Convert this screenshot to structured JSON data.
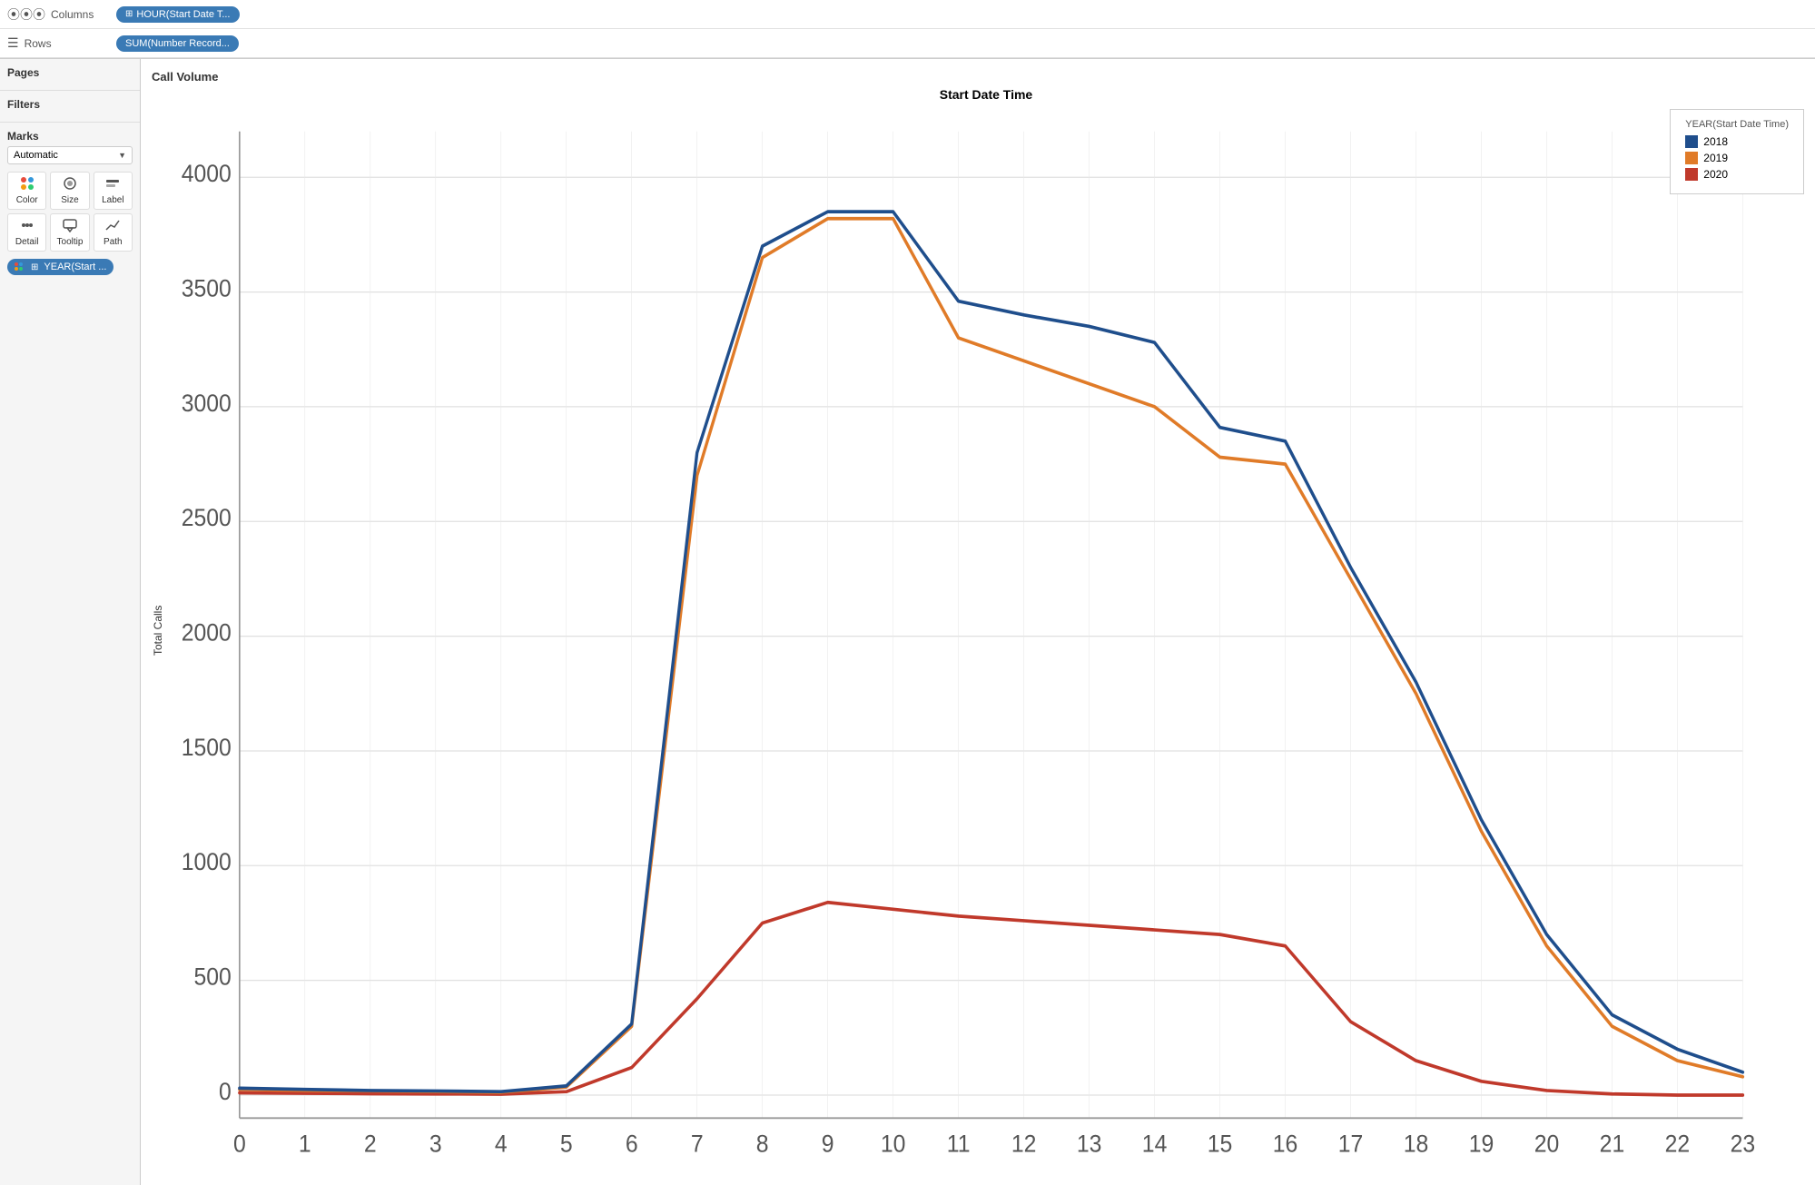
{
  "topbar": {
    "columns_label": "Columns",
    "columns_icon": "≡≡≡",
    "columns_pill": "HOUR(Start Date T...",
    "rows_label": "Rows",
    "rows_icon": "≡",
    "rows_pill": "SUM(Number Record..."
  },
  "left": {
    "pages_title": "Pages",
    "filters_title": "Filters",
    "marks_title": "Marks",
    "marks_dropdown": "Automatic",
    "marks_buttons": [
      {
        "id": "color",
        "label": "Color"
      },
      {
        "id": "size",
        "label": "Size"
      },
      {
        "id": "label",
        "label": "Label"
      },
      {
        "id": "detail",
        "label": "Detail"
      },
      {
        "id": "tooltip",
        "label": "Tooltip"
      },
      {
        "id": "path",
        "label": "Path"
      }
    ],
    "year_pill": "YEAR(Start ..."
  },
  "chart": {
    "title": "Call Volume",
    "x_title": "Start Date Time",
    "y_label": "Total Calls",
    "x_ticks": [
      "0",
      "1",
      "2",
      "3",
      "4",
      "5",
      "6",
      "7",
      "8",
      "9",
      "10",
      "11",
      "12",
      "13",
      "14",
      "15",
      "16",
      "17",
      "18",
      "19",
      "20",
      "21",
      "22",
      "23"
    ],
    "y_ticks": [
      "0",
      "500",
      "1000",
      "1500",
      "2000",
      "2500",
      "3000",
      "3500",
      "4000"
    ],
    "legend_title": "YEAR(Start Date Time)",
    "legend_items": [
      {
        "year": "2018",
        "color": "#1f4e8c"
      },
      {
        "year": "2019",
        "color": "#e07b28"
      },
      {
        "year": "2020",
        "color": "#c0392b"
      }
    ],
    "series": {
      "2018": [
        30,
        25,
        20,
        18,
        15,
        40,
        310,
        2800,
        3700,
        3850,
        3850,
        3460,
        3400,
        3350,
        3280,
        2910,
        2850,
        2300,
        1800,
        1200,
        700,
        350,
        200,
        100
      ],
      "2019": [
        25,
        20,
        18,
        15,
        12,
        35,
        300,
        2700,
        3650,
        3820,
        3820,
        3300,
        3200,
        3100,
        3000,
        2780,
        2750,
        2250,
        1750,
        1150,
        650,
        300,
        150,
        80
      ],
      "2020": [
        10,
        8,
        6,
        5,
        4,
        15,
        120,
        420,
        750,
        840,
        810,
        780,
        760,
        740,
        720,
        700,
        650,
        320,
        150,
        60,
        20,
        5,
        0,
        0
      ]
    }
  }
}
